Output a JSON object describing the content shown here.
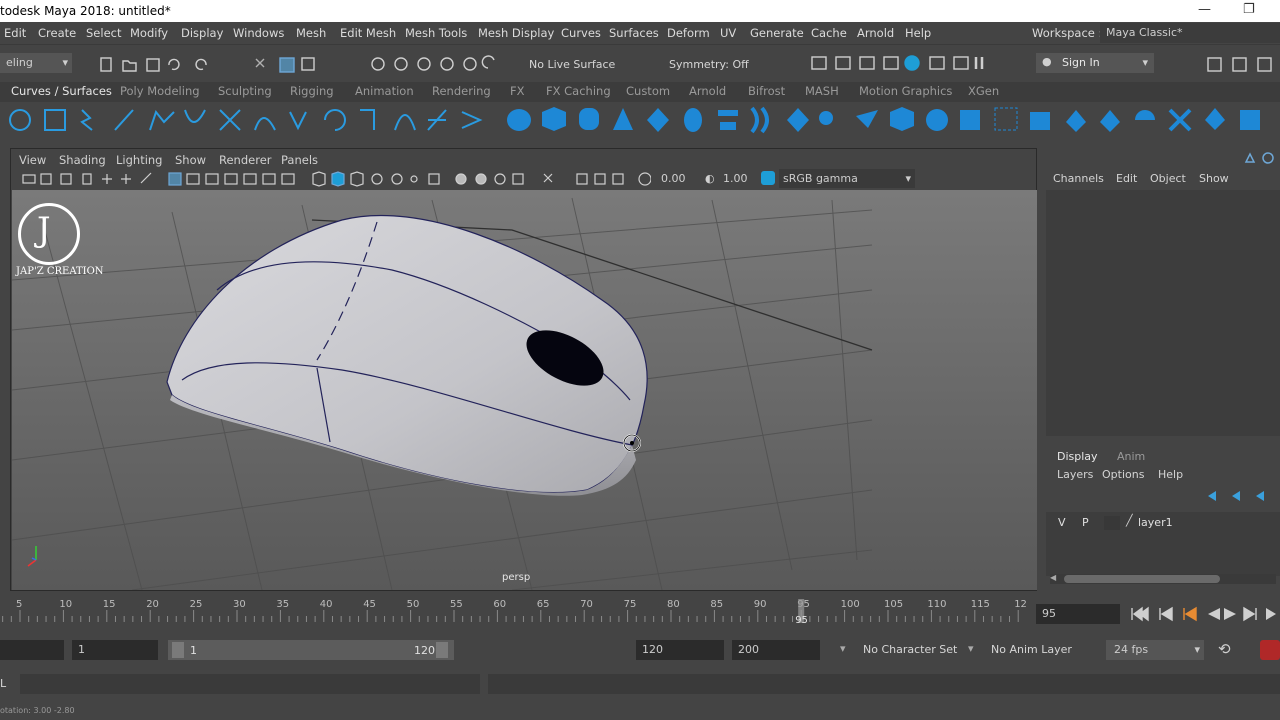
{
  "window": {
    "title": "todesk Maya 2018: untitled*",
    "minimize_glyph": "—",
    "restore_glyph": "❐"
  },
  "menubar": {
    "items": [
      "Edit",
      "Create",
      "Select",
      "Modify",
      "Display",
      "Windows",
      "Mesh",
      "Edit Mesh",
      "Mesh Tools",
      "Mesh Display",
      "Curves",
      "Surfaces",
      "Deform",
      "UV",
      "Generate",
      "Cache",
      "Arnold",
      "Help"
    ],
    "workspace_label": "Workspace :",
    "workspace_value": "Maya Classic*"
  },
  "statusline": {
    "mode": "eling",
    "live_surface": "No Live Surface",
    "symmetry": "Symmetry: Off",
    "sign_in": "Sign In"
  },
  "shelf": {
    "tabs": [
      "Curves / Surfaces",
      "Poly Modeling",
      "Sculpting",
      "Rigging",
      "Animation",
      "Rendering",
      "FX",
      "FX Caching",
      "Custom",
      "Arnold",
      "Bifrost",
      "MASH",
      "Motion Graphics",
      "XGen"
    ],
    "active_tab": 0
  },
  "viewport": {
    "panel_menus": [
      "View",
      "Shading",
      "Lighting",
      "Show",
      "Renderer",
      "Panels"
    ],
    "exposure": "0.00",
    "gamma": "1.00",
    "color_space": "sRGB gamma",
    "camera_label": "persp",
    "watermark_text": "JAP'Z CREATION",
    "watermark_letter": "J"
  },
  "channel_box": {
    "menus": [
      "Channels",
      "Edit",
      "Object",
      "Show"
    ]
  },
  "layer_editor": {
    "tabs": [
      "Display",
      "Anim"
    ],
    "menus": [
      "Layers",
      "Options",
      "Help"
    ],
    "layers": [
      {
        "v": "V",
        "p": "P",
        "name": "layer1"
      }
    ]
  },
  "timeline": {
    "ticks": [
      "5",
      "10",
      "15",
      "20",
      "25",
      "30",
      "35",
      "40",
      "45",
      "50",
      "55",
      "60",
      "65",
      "70",
      "75",
      "80",
      "85",
      "90",
      "95",
      "100",
      "105",
      "110",
      "115",
      "12"
    ],
    "current_frame": "95",
    "current_field": "95"
  },
  "range": {
    "start": "1",
    "range_start": "1",
    "range_end": "120",
    "end": "120",
    "anim_end": "200",
    "character_set": "No Character Set",
    "anim_layer": "No Anim Layer",
    "fps": "24 fps"
  },
  "cmdline": {
    "mel_label": "L"
  },
  "helpline": {
    "text": "otation:   3.00      -2.80"
  },
  "colors": {
    "accent": "#5285a6",
    "shelf_icon": "#1e88d6",
    "highlight": "#6ea7d6",
    "panel": "#444444",
    "field": "#2b2b2b"
  }
}
